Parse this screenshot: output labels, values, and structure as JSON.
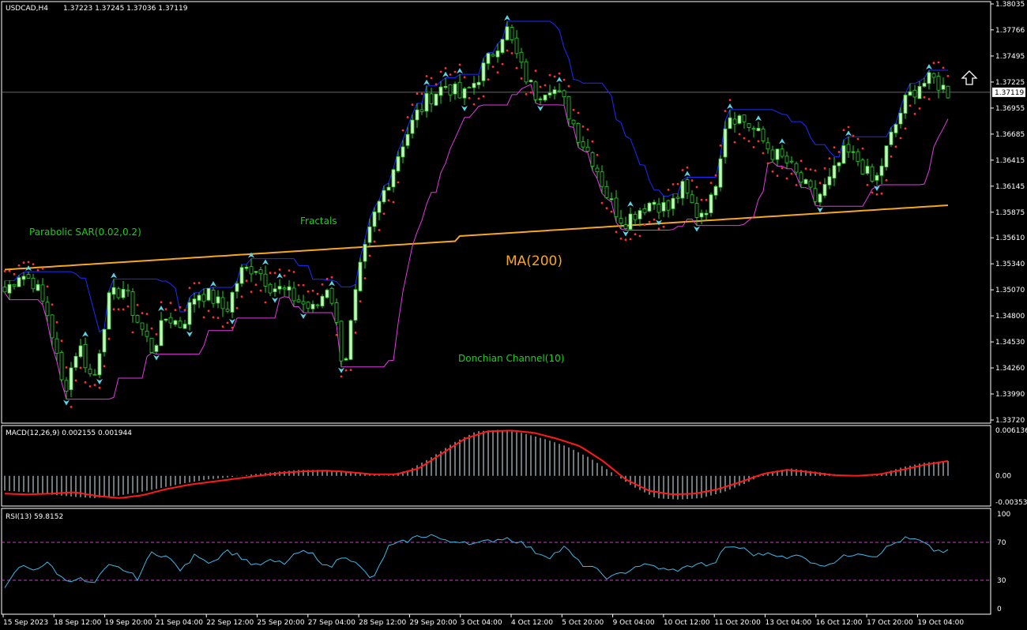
{
  "header": {
    "symbol": "USDCAD,H4",
    "ohlc": "1.37223 1.37245 1.37036 1.37119"
  },
  "colors": {
    "background": "#000000",
    "bull_candle": "#c8f5c0",
    "bear_candle": "#000000",
    "wick": "#2ecc2e",
    "sar": "#ff3030",
    "donchian_upper": "#1c2cff",
    "donchian_lower": "#e23ae2",
    "ma200": "#f5a623",
    "fractal": "#5fd3e6",
    "macd_hist": "#d8f0f8",
    "macd_signal": "#ff1a1a",
    "rsi": "#40b8e8",
    "level": "#c83cc8"
  },
  "labels": {
    "sar": "Parabolic SAR(0.02,0.2)",
    "fractals": "Fractals",
    "ma": "MA(200)",
    "donchian": "Donchian Channel(10)",
    "macd": "MACD(12,26,9) 0.002155 0.001944",
    "rsi": "RSI(13) 59.8152",
    "arrow_icon": "up-arrow-icon"
  },
  "current_price": "1.37119",
  "chart_data": [
    {
      "type": "candlestick",
      "title": "USDCAD,H4",
      "yaxis_ticks": [
        "1.38035",
        "1.37766",
        "1.37495",
        "1.37225",
        "1.36955",
        "1.36685",
        "1.36415",
        "1.36145",
        "1.35875",
        "1.35610",
        "1.35340",
        "1.35070",
        "1.34800",
        "1.34530",
        "1.34260",
        "1.33990",
        "1.33720"
      ],
      "ylim": [
        1.3372,
        1.38035
      ],
      "x_labels": [
        "15 Sep 2023",
        "18 Sep 12:00",
        "19 Sep 20:00",
        "21 Sep 04:00",
        "22 Sep 12:00",
        "25 Sep 20:00",
        "27 Sep 04:00",
        "28 Sep 12:00",
        "29 Sep 20:00",
        "3 Oct 04:00",
        "4 Oct 12:00",
        "5 Oct 20:00",
        "9 Oct 04:00",
        "10 Oct 12:00",
        "11 Oct 20:00",
        "13 Oct 04:00",
        "16 Oct 12:00",
        "17 Oct 20:00",
        "19 Oct 04:00"
      ],
      "close_anchors": [
        1.3505,
        1.3525,
        1.3515,
        1.3478,
        1.34,
        1.3452,
        1.341,
        1.3495,
        1.351,
        1.3475,
        1.3445,
        1.348,
        1.347,
        1.3505,
        1.35,
        1.3485,
        1.3525,
        1.3532,
        1.3512,
        1.3505,
        1.3495,
        1.3485,
        1.3515,
        1.3425,
        1.352,
        1.358,
        1.362,
        1.366,
        1.369,
        1.371,
        1.372,
        1.3705,
        1.3725,
        1.375,
        1.378,
        1.3738,
        1.371,
        1.372,
        1.37,
        1.3665,
        1.364,
        1.36,
        1.3578,
        1.359,
        1.36,
        1.359,
        1.3612,
        1.3585,
        1.36,
        1.369,
        1.3685,
        1.367,
        1.365,
        1.364,
        1.362,
        1.36,
        1.362,
        1.365,
        1.364,
        1.3615,
        1.366,
        1.37,
        1.372,
        1.3725,
        1.3712
      ]
    },
    {
      "type": "line",
      "title": "MACD(12,26,9) 0.002155 0.001944",
      "yaxis_ticks": [
        "0.006136",
        "0.00",
        "-0.003536"
      ],
      "ylim": [
        -0.003536,
        0.006136
      ],
      "histogram_anchors": [
        -0.002,
        -0.0022,
        -0.0025,
        -0.0028,
        -0.003,
        -0.0027,
        -0.0022,
        -0.0016,
        -0.001,
        -0.0005,
        -0.0002,
        0.0002,
        0.0005,
        0.0008,
        0.0008,
        0.0006,
        0.0003,
        0.0,
        0.0008,
        0.0025,
        0.0045,
        0.006,
        0.0062,
        0.0058,
        0.005,
        0.004,
        0.0025,
        0.0005,
        -0.0015,
        -0.003,
        -0.0032,
        -0.003,
        -0.0022,
        -0.001,
        0.0005,
        0.001,
        0.0006,
        0.0002,
        -0.0001,
        0.0003,
        0.0012,
        0.0018,
        0.002
      ],
      "signal_anchors": [
        -0.0024,
        -0.0025,
        -0.0024,
        -0.0022,
        -0.0027,
        -0.003,
        -0.0026,
        -0.0018,
        -0.0012,
        -0.0008,
        -0.0004,
        0.0,
        0.0004,
        0.0006,
        0.0007,
        0.0005,
        0.0002,
        0.0002,
        0.001,
        0.003,
        0.005,
        0.006,
        0.0061,
        0.0058,
        0.005,
        0.004,
        0.002,
        -0.0005,
        -0.002,
        -0.0025,
        -0.0024,
        -0.0018,
        -0.0008,
        0.0003,
        0.0008,
        0.0005,
        0.0001,
        0.0,
        0.0002,
        0.0008,
        0.0015,
        0.002
      ]
    },
    {
      "type": "line",
      "title": "RSI(13) 59.8152",
      "yaxis_ticks": [
        "100",
        "70",
        "30",
        "0"
      ],
      "ylim": [
        0,
        100
      ],
      "levels": [
        70,
        30
      ],
      "values": [
        20,
        45,
        42,
        48,
        30,
        32,
        25,
        45,
        42,
        32,
        60,
        55,
        40,
        58,
        48,
        62,
        55,
        45,
        50,
        48,
        60,
        57,
        42,
        58,
        45,
        30,
        65,
        70,
        76,
        78,
        70,
        72,
        68,
        72,
        75,
        70,
        60,
        55,
        65,
        48,
        42,
        32,
        38,
        46,
        45,
        40,
        42,
        48,
        45,
        66,
        64,
        56,
        60,
        52,
        58,
        46,
        48,
        55,
        60,
        55,
        66,
        74,
        72,
        62,
        60
      ]
    }
  ]
}
